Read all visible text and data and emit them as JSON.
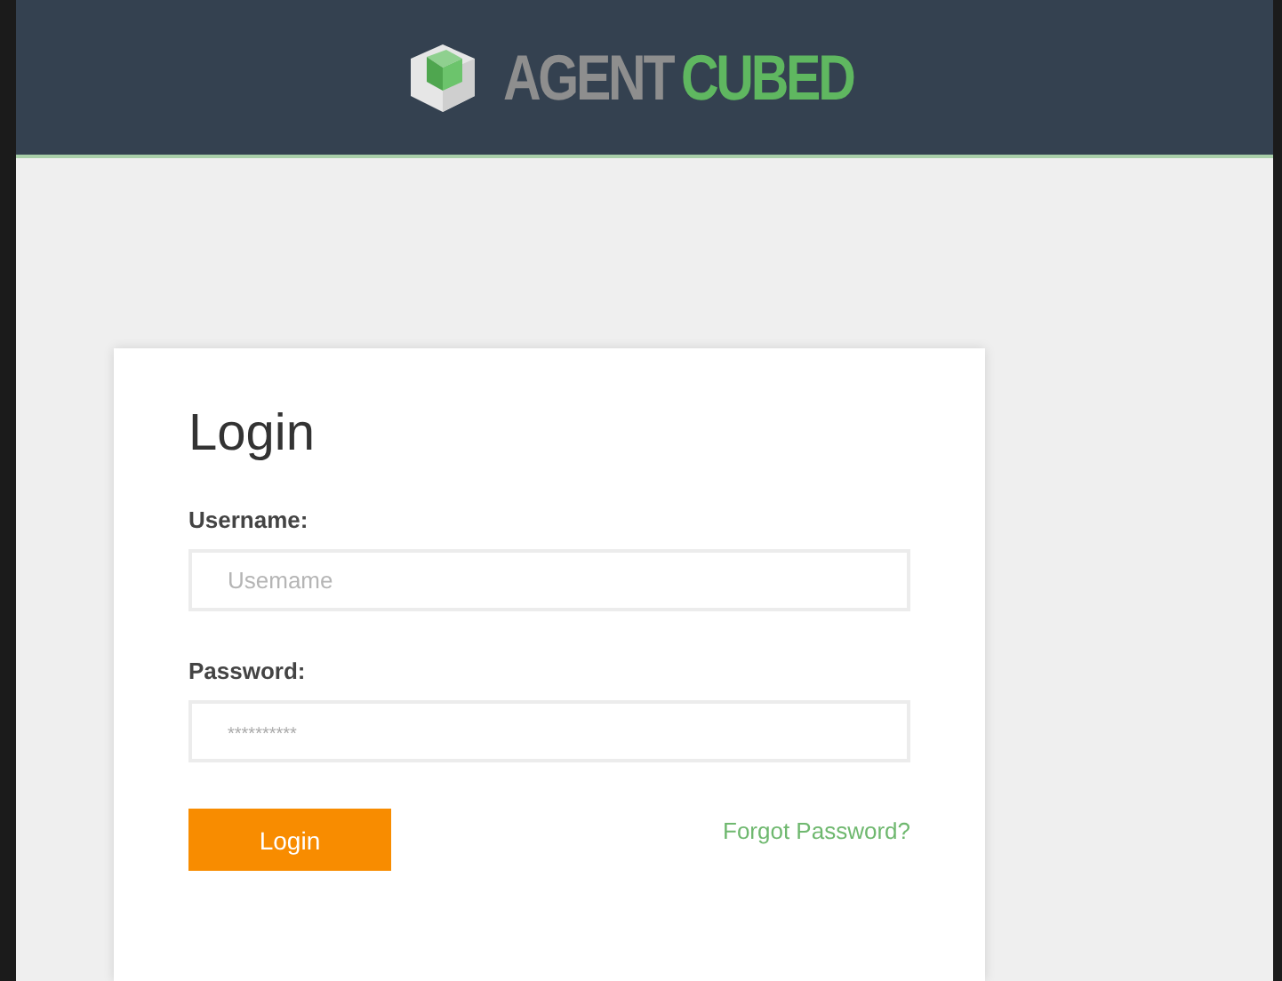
{
  "header": {
    "logo": [
      {
        "text": "AGENT",
        "color": "#8e8e8e"
      },
      {
        "text": "CUBED",
        "color": "#5fb760"
      }
    ]
  },
  "login": {
    "title": "Login",
    "fields": [
      {
        "label": "Username:",
        "placeholder": "Usemame",
        "kind": "text"
      },
      {
        "label": "Password:",
        "placeholder": "**********",
        "kind": "password"
      }
    ],
    "submit": "Login",
    "forgot_link": "Forgot Password?"
  }
}
